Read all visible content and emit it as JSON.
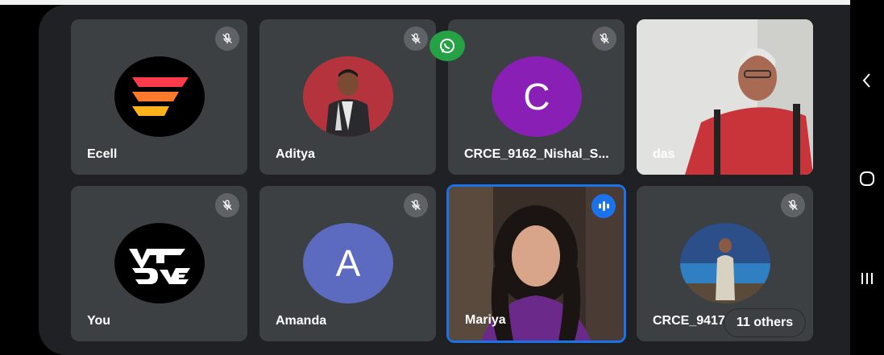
{
  "participants": [
    {
      "name": "Ecell"
    },
    {
      "name": "Aditya"
    },
    {
      "name": "CRCE_9162_Nishal_S...",
      "initial": "C"
    },
    {
      "name": "das"
    },
    {
      "name": "You"
    },
    {
      "name": "Amanda",
      "initial": "A"
    },
    {
      "name": "Mariya"
    },
    {
      "name": "CRCE_9417"
    }
  ],
  "vinit_logo_text": "VINIT DAVE",
  "others_label": "11 others",
  "colors": {
    "background": "#202124",
    "tile": "#3c4043",
    "nishal_avatar": "#8a1fb5",
    "amanda_avatar": "#5c6bc0",
    "active_speaker_border": "#1a73e8",
    "whatsapp": "#25a244"
  },
  "icons": {
    "mute": "microphone-off-icon",
    "speaking": "audio-wave-icon",
    "overlay": "whatsapp-icon",
    "nav_back": "chevron-left-icon",
    "nav_home": "home-icon",
    "nav_recents": "recents-icon"
  }
}
